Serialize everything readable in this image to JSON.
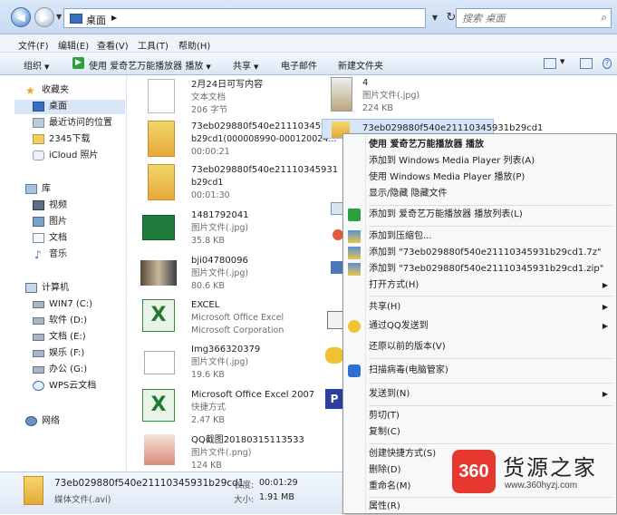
{
  "address": {
    "location": "桌面",
    "search_placeholder": "搜索 桌面"
  },
  "menubar": [
    "文件(F)",
    "编辑(E)",
    "查看(V)",
    "工具(T)",
    "帮助(H)"
  ],
  "toolbar": {
    "organize": "组织",
    "play_with": "使用 爱奇艺万能播放器 播放",
    "share": "共享",
    "email": "电子邮件",
    "new_folder": "新建文件夹"
  },
  "nav": {
    "favorites": "收藏夹",
    "favorites_items": [
      "桌面",
      "最近访问的位置",
      "2345下载",
      "iCloud 照片"
    ],
    "libraries": "库",
    "library_items": [
      "视频",
      "图片",
      "文档",
      "音乐"
    ],
    "computer": "计算机",
    "drives": [
      "WIN7 (C:)",
      "软件 (D:)",
      "文档 (E:)",
      "娱乐 (F:)",
      "办公 (G:)",
      "WPS云文档"
    ],
    "network": "网络"
  },
  "files": [
    {
      "name": "2月24日可写内容",
      "line2": "文本文档",
      "line3": "206 字节"
    },
    {
      "name": "73eb029880f540e21110345931",
      "line2": "b29cd1(000008990-000120024...",
      "line3": "00:00:21"
    },
    {
      "name": "73eb029880f540e21110345931",
      "line2": "b29cd1",
      "line3": "00:01:30"
    },
    {
      "name": "1481792041",
      "line2": "图片文件(.jpg)",
      "line3": "35.8 KB"
    },
    {
      "name": "bji04780096",
      "line2": "图片文件(.jpg)",
      "line3": "80.6 KB"
    },
    {
      "name": "EXCEL",
      "line2": "Microsoft Office Excel",
      "line3": "Microsoft Corporation"
    },
    {
      "name": "Img366320379",
      "line2": "图片文件(.jpg)",
      "line3": "19.6 KB"
    },
    {
      "name": "Microsoft Office Excel 2007",
      "line2": "快捷方式",
      "line3": "2.47 KB"
    },
    {
      "name": "QQ截图20180315113533",
      "line2": "图片文件(.png)",
      "line3": "124 KB"
    }
  ],
  "files_right": [
    {
      "name": "4",
      "line2": "图片文件(.jpg)",
      "line3": "224 KB"
    },
    {
      "name": "73eb029880f540e21110345931b29cd1"
    }
  ],
  "context_menu": {
    "play": "使用 爱奇艺万能播放器 播放",
    "wmp_add": "添加到 Windows Media Player 列表(A)",
    "wmp_play": "使用 Windows Media Player 播放(P)",
    "show_hide": "显示/隐藏 隐藏文件",
    "add_playlist": "添加到 爱奇艺万能播放器 播放列表(L)",
    "add_archive": "添加到压缩包...",
    "add_7z": "添加到 \"73eb029880f540e21110345931b29cd1.7z\"",
    "add_zip": "添加到 \"73eb029880f540e21110345931b29cd1.zip\"",
    "open_with": "打开方式(H)",
    "share": "共享(H)",
    "qq_send": "通过QQ发送到",
    "restore": "还原以前的版本(V)",
    "scan": "扫描病毒(电脑管家)",
    "send_to": "发送到(N)",
    "cut": "剪切(T)",
    "copy": "复制(C)",
    "shortcut": "创建快捷方式(S)",
    "delete": "删除(D)",
    "rename": "重命名(M)",
    "properties": "属性(R)"
  },
  "details": {
    "name": "73eb029880f540e21110345931b29cd1",
    "type": "媒体文件(.avi)",
    "length_label": "长度:",
    "length": "00:01:29",
    "size_label": "大小:",
    "size": "1.91 MB"
  },
  "watermark": {
    "logo": "360",
    "title": "货源之家",
    "url": "www.360hyzj.com"
  },
  "colors": {
    "accent": "#3a6fbf",
    "selection": "#d6e6f8",
    "watermark_red": "#e6382f"
  }
}
